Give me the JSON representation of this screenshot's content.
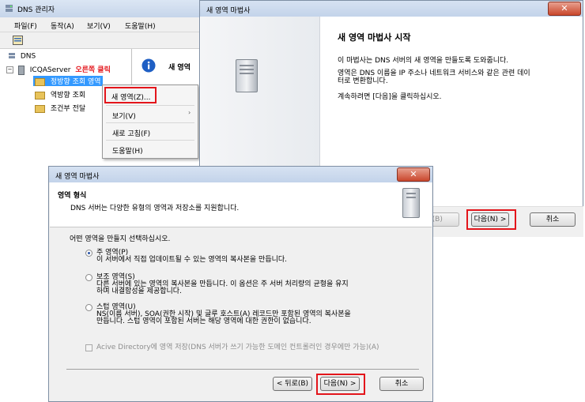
{
  "dns_manager": {
    "title": "DNS 관리자",
    "menu": [
      "파일(F)",
      "동작(A)",
      "보기(V)",
      "도움말(H)"
    ],
    "tree": {
      "root": "DNS",
      "server": "ICQAServer",
      "annotation": "오른쪽 클릭",
      "zones": [
        "정방향 조회 영역",
        "역방향 조회",
        "조건부 전달"
      ]
    },
    "right_pane_title": "새 영역",
    "context_menu": {
      "items": [
        "새 영역(Z)...",
        "보기(V)",
        "새로 고침(F)",
        "도움말(H)"
      ]
    }
  },
  "wizard_start": {
    "title": "새 영역 마법사",
    "heading": "새 영역 마법사 시작",
    "para1": "이 마법사는 DNS 서버의 새 영역을 만들도록 도와줍니다.",
    "para2_line1": "영역은 DNS 이름을 IP 주소나 네트워크 서비스와 같은 관련 데이",
    "para2_line2": "터로 변환합니다.",
    "para3": "계속하려면 [다음]을 클릭하십시오.",
    "back_label": "뒤로(B)",
    "next_label": "다음(N) >",
    "cancel_label": "취소"
  },
  "wizard_zone_type": {
    "title": "새 영역 마법사",
    "header_title": "영역 형식",
    "header_desc": "DNS 서버는 다양한 유형의 영역과 저장소를 지원합니다.",
    "prompt": "어떤 영역을 만들지 선택하십시오.",
    "options": [
      {
        "label": "주 영역(P)",
        "desc1": "이 서버에서 직접 업데이트될 수 있는 영역의 복사본을 만듭니다.",
        "desc2": "",
        "selected": true
      },
      {
        "label": "보조 영역(S)",
        "desc1": "다른 서버에 있는 영역의 복사본을 만듭니다. 이 옵션은 주 서버 처리량의 균형을 유지",
        "desc2": "하며 내결함성을 제공합니다.",
        "selected": false
      },
      {
        "label": "스텁 영역(U)",
        "desc1": "NS(이름 서버), SOA(권한 시작) 및 글루 호스트(A) 레코드만 포함된 영역의 복사본을",
        "desc2": "만듭니다. 스텁 영역이 포함된 서버는 해당 영역에 대한 권한이 없습니다.",
        "selected": false
      }
    ],
    "ad_checkbox": "Acive Directory에 영역 저장(DNS 서버가 쓰기 가능한 도메인 컨트롤러인 경우에만 가능)(A)",
    "back_label": "< 뒤로(B)",
    "next_label": "다음(N) >",
    "cancel_label": "취소"
  },
  "colors": {
    "highlight_red": "#e3151b",
    "annotation_red": "#e3151b",
    "selection_blue": "#3399ff"
  }
}
